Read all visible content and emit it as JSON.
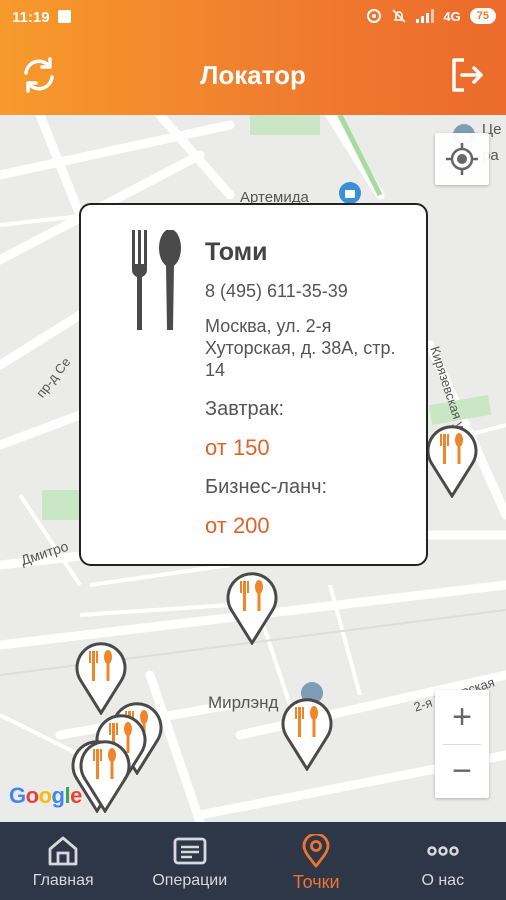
{
  "status_bar": {
    "time": "11:19",
    "network": "4G",
    "battery": "75"
  },
  "app_bar": {
    "title": "Локатор",
    "refresh_icon": "refresh-icon",
    "logout_icon": "logout-icon"
  },
  "map": {
    "labels": {
      "artemida": "Артемида",
      "mirlend": "Мирлэнд",
      "pr_d": "пр-д Се",
      "dmitro": "Дмитро",
      "khutorskaya": "2-я Хуторская",
      "yazev": "Кирязевская у",
      "tse": "Це",
      "ra": "ра"
    },
    "zoom_in": "+",
    "zoom_out": "−",
    "attribution": "Google",
    "attribution_colors": [
      "#4285F4",
      "#EA4335",
      "#FBBC05",
      "#4285F4",
      "#34A853",
      "#EA4335"
    ]
  },
  "place_card": {
    "name": "Томи",
    "phone": "8 (495) 611-35-39",
    "address": "Москва, ул. 2-я Хуторская, д. 38А, стр. 14",
    "breakfast_label": "Завтрак:",
    "breakfast_price": "от 150",
    "lunch_label": "Бизнес-ланч:",
    "lunch_price": "от 200",
    "icon": "fork-knife-icon"
  },
  "bottom_nav": {
    "items": [
      {
        "label": "Главная",
        "icon": "home-icon"
      },
      {
        "label": "Операции",
        "icon": "operations-icon"
      },
      {
        "label": "Точки",
        "icon": "location-pin-icon",
        "active": true
      },
      {
        "label": "О нас",
        "icon": "more-icon"
      }
    ]
  },
  "colors": {
    "accent": "#EE7430",
    "nav_background": "#2E3748",
    "pin_orange": "#F0852A"
  }
}
